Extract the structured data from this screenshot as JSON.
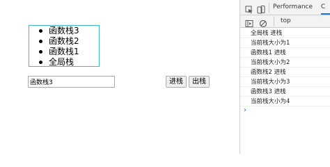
{
  "stack": {
    "items": [
      "函数栈3",
      "函数栈2",
      "函数栈1",
      "全局栈"
    ]
  },
  "controls": {
    "input_value": "函数栈3",
    "push_label": "进栈",
    "pop_label": "出栈"
  },
  "devtools": {
    "tabs": [
      "Performance",
      "C"
    ],
    "active_tab": "C",
    "context": "top",
    "console_lines": [
      "全局栈  进栈",
      "当前栈大小为1",
      "函数栈1  进栈",
      "当前栈大小为2",
      "函数栈2  进栈",
      "当前栈大小为3",
      "函数栈3  进栈",
      "当前栈大小为4"
    ],
    "prompt": "›"
  },
  "colors": {
    "box_border": "#3db8c8",
    "prompt": "#1a73e8"
  }
}
